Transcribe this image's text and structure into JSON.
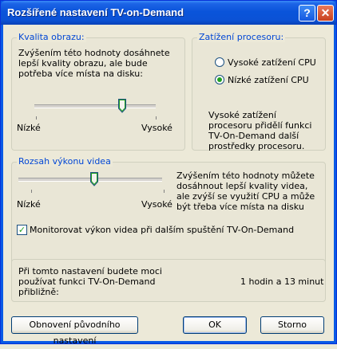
{
  "window": {
    "title": "Rozšířené nastavení TV-on-Demand",
    "help_label": "?",
    "close_label": "✕"
  },
  "quality": {
    "legend": "Kvalita obrazu:",
    "description": "Zvýšením této hodnoty dosáhnete lepší kvality obrazu, ale bude potřeba více místa na disku:",
    "min_label": "Nízké",
    "max_label": "Vysoké",
    "slider_level": 0.75
  },
  "cpu": {
    "legend": "Zatížení procesoru:",
    "options": [
      "Vysoké zatížení CPU",
      "Nízké zatížení CPU"
    ],
    "selected": "Nízké zatížení CPU",
    "description": "Vysoké zatížení procesoru přidělí funkci TV-On-Demand další prostředky procesoru."
  },
  "performance": {
    "legend": "Rozsah výkonu videa",
    "description": "Zvýšením této hodnoty můžete dosáhnout lepší kvality videa, ale zvýší se využití CPU a může být třeba více místa na disku",
    "min_label": "Nízké",
    "max_label": "Vysoké",
    "slider_level": 0.5,
    "monitor_checkbox_label": "Monitorovat výkon videa při dalším spuštění TV-On-Demand",
    "monitor_checked": true
  },
  "estimate": {
    "text": "Při tomto nastavení budete moci používat funkci TV-On-Demand přibližně:",
    "value": "1 hodin a 13 minut"
  },
  "buttons": {
    "restore": "Obnovení původního nastavení",
    "ok": "OK",
    "cancel": "Storno"
  }
}
